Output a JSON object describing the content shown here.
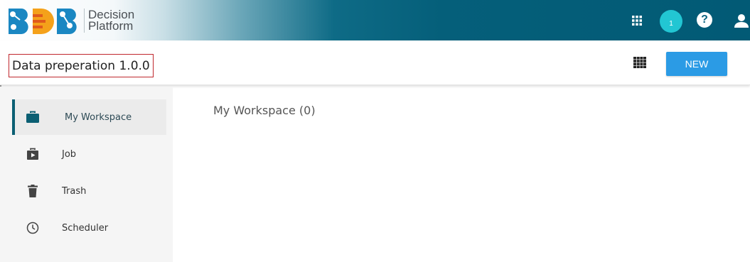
{
  "brand": {
    "logo_icon": "bdb-logo-icon",
    "name_line1": "Decision",
    "name_line2": "Platform"
  },
  "topbar": {
    "apps_icon": "apps-grid-icon",
    "notification_count": "1",
    "help_icon": "help-icon",
    "user_icon": "user-icon",
    "colors": {
      "gradient_end": "#025a75",
      "notification": "#22c6d3"
    }
  },
  "subbar": {
    "title": "Data preperation 1.0.0",
    "grid_icon": "apps-grid-icon",
    "new_button": "NEW",
    "colors": {
      "new_button": "#2b9be5",
      "title_border": "#c0272d"
    }
  },
  "sidebar": {
    "items": [
      {
        "label": "My Workspace",
        "icon": "briefcase-icon",
        "active": true
      },
      {
        "label": "Job",
        "icon": "job-play-icon",
        "active": false
      },
      {
        "label": "Trash",
        "icon": "trash-icon",
        "active": false
      },
      {
        "label": "Scheduler",
        "icon": "clock-icon",
        "active": false
      }
    ],
    "colors": {
      "active_indicator": "#0b5f73"
    }
  },
  "main": {
    "title": "My Workspace (0)"
  }
}
